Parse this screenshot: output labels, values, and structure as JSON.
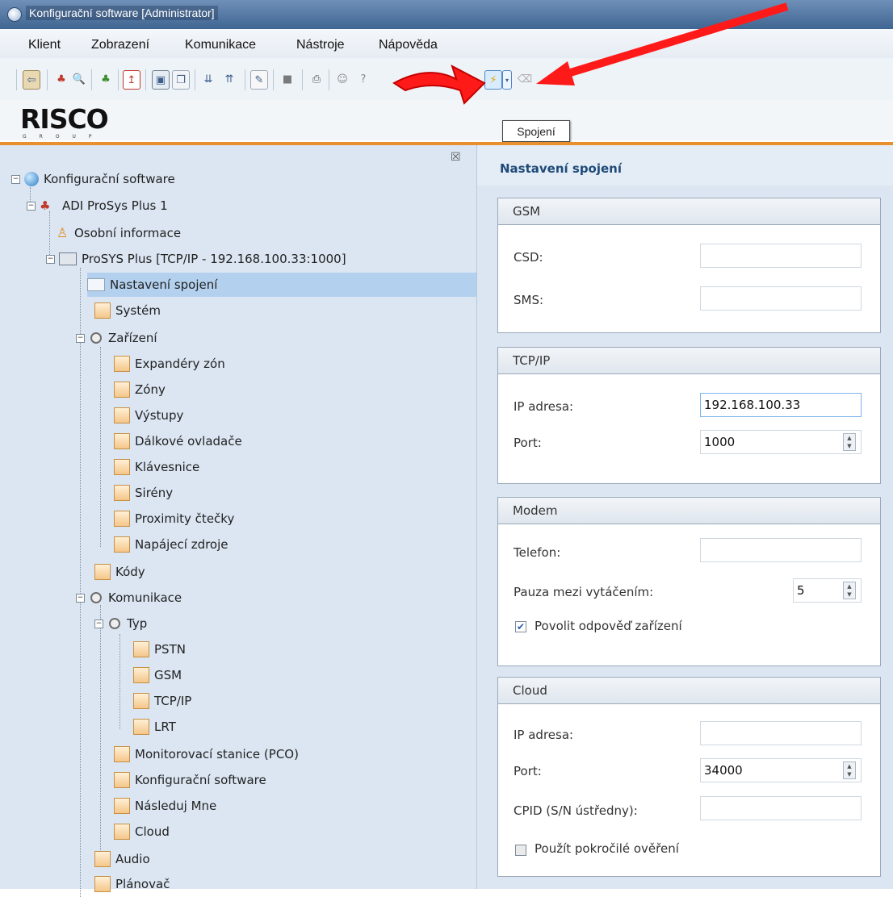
{
  "window": {
    "title": "Konfigurační software  [Administrator]"
  },
  "menu": {
    "items": [
      "Klient",
      "Zobrazení",
      "Komunikace",
      "Nástroje",
      "Nápověda"
    ]
  },
  "logo": {
    "name": "RISCO",
    "sub": "GROUP"
  },
  "tooltip": "Spojení",
  "toolbar": {
    "icons": [
      "exit-icon",
      "find-icon",
      "search-icon",
      "network-icon",
      "import-icon",
      "save-icon",
      "copy-icon",
      "download-icon",
      "upload-icon",
      "edit-icon",
      "lock-icon",
      "print-icon",
      "user-icon",
      "help-icon",
      "connect-icon",
      "dropdown-icon",
      "disconnect-icon"
    ]
  },
  "tree": {
    "root": "Konfigurační software",
    "account": "ADI ProSys Plus 1",
    "personal": "Osobní informace",
    "panel": "ProSYS Plus [TCP/IP - 192.168.100.33:1000]",
    "connection": "Nastavení spojení",
    "system": "Systém",
    "devices": "Zařízení",
    "device_items": [
      "Expandéry zón",
      "Zóny",
      "Výstupy",
      "Dálkové ovladače",
      "Klávesnice",
      "Sirény",
      "Proximity čtečky",
      "Napájecí zdroje"
    ],
    "codes": "Kódy",
    "communication": "Komunikace",
    "type": "Typ",
    "type_items": [
      "PSTN",
      "GSM",
      "TCP/IP",
      "LRT"
    ],
    "comm_items": [
      "Monitorovací stanice (PCO)",
      "Konfigurační software",
      "Následuj Mne",
      "Cloud"
    ],
    "audio": "Audio",
    "scheduler": "Plánovač"
  },
  "settings": {
    "title": "Nastavení spojení",
    "gsm": {
      "header": "GSM",
      "csd_label": "CSD:",
      "csd_value": "",
      "sms_label": "SMS:",
      "sms_value": ""
    },
    "tcpip": {
      "header": "TCP/IP",
      "ip_label": "IP adresa:",
      "ip_value": "192.168.100.33",
      "port_label": "Port:",
      "port_value": "1000"
    },
    "modem": {
      "header": "Modem",
      "phone_label": "Telefon:",
      "phone_value": "",
      "pause_label": "Pauza mezi vytáčením:",
      "pause_value": "5",
      "answer_label": "Povolit odpověď zařízení",
      "answer_checked": true
    },
    "cloud": {
      "header": "Cloud",
      "ip_label": "IP adresa:",
      "ip_value": "",
      "port_label": "Port:",
      "port_value": "34000",
      "cpid_label": "CPID (S/N ústředny):",
      "cpid_value": "",
      "advanced_label": "Použít pokročilé ověření",
      "advanced_checked": false
    }
  },
  "colors": {
    "accent_orange": "#e8902e",
    "annotation_red": "#ff1a1a",
    "selection": "#b3d1ee",
    "title_blue": "#1f4a78"
  }
}
